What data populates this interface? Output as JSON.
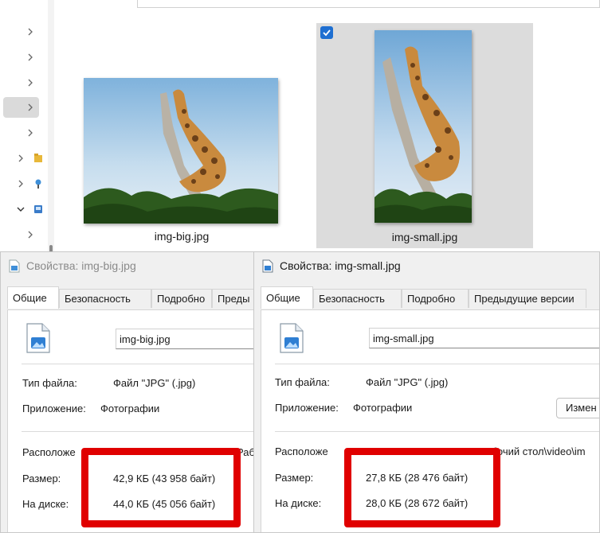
{
  "explorer": {
    "files": [
      {
        "name": "img-big.jpg",
        "selected": false
      },
      {
        "name": "img-small.jpg",
        "selected": true
      }
    ]
  },
  "dialogs": [
    {
      "title": "Свойства: img-big.jpg",
      "tabs": [
        "Общие",
        "Безопасность",
        "Подробно",
        "Преды"
      ],
      "file_name": "img-big.jpg",
      "labels": {
        "file_type": "Тип файла:",
        "app": "Приложение:",
        "location": "Расположе",
        "size": "Размер:",
        "on_disk": "На диске:"
      },
      "values": {
        "file_type": "Файл \"JPG\" (.jpg)",
        "app": "Фотографии",
        "location": "Раб",
        "size": "42,9 КБ (43 958 байт)",
        "on_disk": "44,0 КБ (45 056 байт)"
      }
    },
    {
      "title": "Свойства: img-small.jpg",
      "tabs": [
        "Общие",
        "Безопасность",
        "Подробно",
        "Предыдущие версии"
      ],
      "file_name": "img-small.jpg",
      "labels": {
        "file_type": "Тип файла:",
        "app": "Приложение:",
        "location": "Расположе",
        "size": "Размер:",
        "on_disk": "На диске:"
      },
      "values": {
        "file_type": "Файл \"JPG\" (.jpg)",
        "app": "Фотографии",
        "location": "Рабочий стол\\video\\im",
        "size": "27,8 КБ (28 476 байт)",
        "on_disk": "28,0 КБ (28 672 байт)"
      },
      "change_button": "Измен"
    }
  ],
  "colors": {
    "highlight": "#e00000",
    "accent": "#1e6fd1",
    "selection": "#dcdcdc"
  }
}
